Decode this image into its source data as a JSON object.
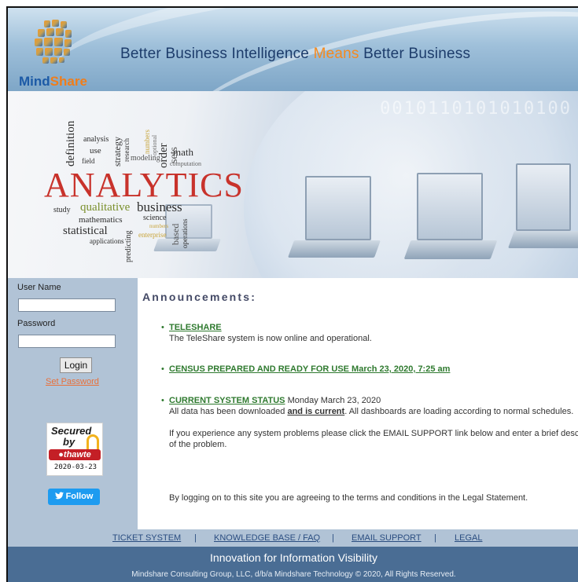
{
  "header": {
    "logo": {
      "mind": "Mind",
      "share": "Share"
    },
    "tagline": {
      "part1": "Better Business Intelligence",
      "means": "Means",
      "part2": "Better Business"
    },
    "colors": {
      "brand_blue": "#1c5aa6",
      "brand_orange": "#f58a1f"
    }
  },
  "hero": {
    "headline_word": "ANALYTICS",
    "words": [
      "definition",
      "analysis",
      "strategy",
      "research",
      "numbers",
      "use",
      "field",
      "modeling",
      "order",
      "sets",
      "math",
      "optional",
      "computation",
      "study",
      "qualitative",
      "business",
      "science",
      "mathematics",
      "statistical",
      "applications",
      "numbers",
      "enterprise",
      "based",
      "operations",
      "predicting"
    ],
    "binary": "0010110101010100"
  },
  "login": {
    "username_label": "User Name",
    "username_value": "",
    "password_label": "Password",
    "password_value": "",
    "login_button": "Login",
    "set_password": "Set Password"
  },
  "seal": {
    "line1": "Secured",
    "line2": "by",
    "brand": "thawte",
    "date": "2020-03-23"
  },
  "twitter": {
    "label": "Follow",
    "icon": "bird-icon"
  },
  "announcements": {
    "title": "Announcements:",
    "items": [
      {
        "link": "TELESHARE",
        "text": "The TeleShare system is now online and operational."
      },
      {
        "link": "CENSUS PREPARED AND READY FOR USE March 23, 2020, 7:25 am"
      },
      {
        "link": "CURRENT SYSTEM STATUS",
        "date": "Monday March 23, 2020",
        "line1_a": "All data has been downloaded ",
        "line1_b": "and is current",
        "line1_c": ". All dashboards are loading according to normal schedules.",
        "line2": "If you experience any system problems please click the EMAIL SUPPORT link below and enter a brief description",
        "line3": "of the problem."
      }
    ],
    "legal_notice": "By logging on to this site you are agreeing to the terms and conditions in the Legal Statement."
  },
  "footer": {
    "links": [
      "TICKET SYSTEM",
      "KNOWLEDGE BASE / FAQ",
      "EMAIL SUPPORT",
      "LEGAL"
    ],
    "separator": "|",
    "title": "Innovation for Information Visibility",
    "copyright": "Mindshare Consulting Group, LLC, d/b/a Mindshare Technology © 2020, All Rights Reserved."
  }
}
